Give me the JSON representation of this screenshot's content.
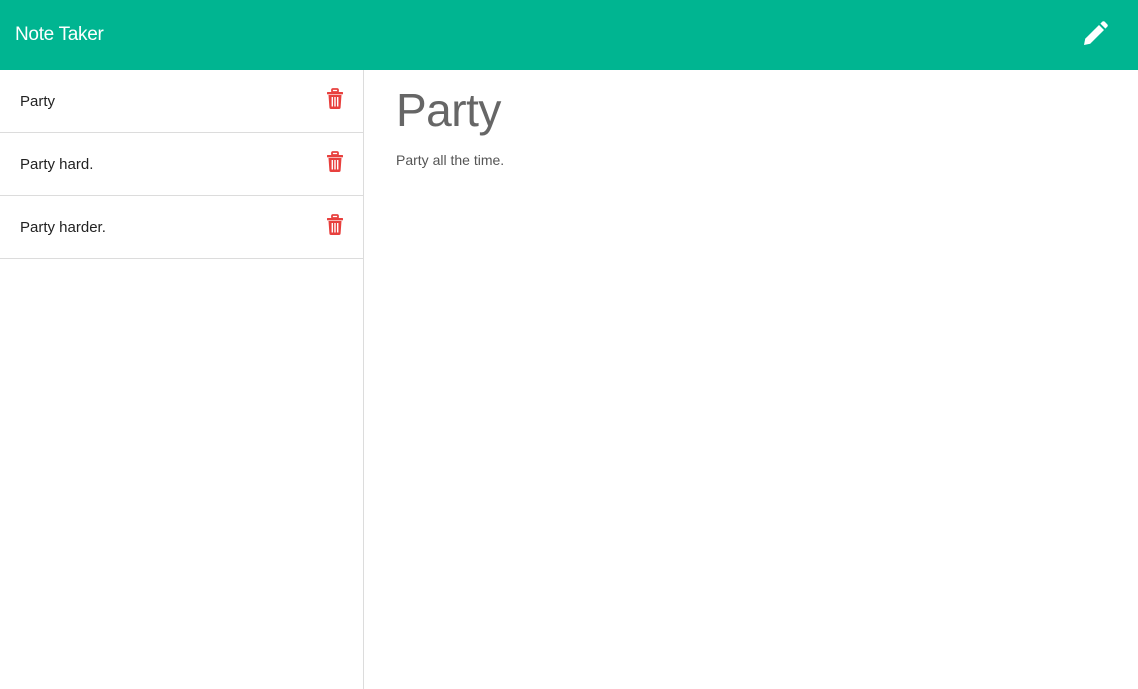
{
  "navbar": {
    "brand": "Note Taker",
    "new_note_icon": "pencil-icon",
    "background_color": "#00b591"
  },
  "notes": [
    {
      "title": "Party",
      "delete_icon": "trash-icon"
    },
    {
      "title": "Party hard.",
      "delete_icon": "trash-icon"
    },
    {
      "title": "Party harder.",
      "delete_icon": "trash-icon"
    }
  ],
  "active_note": {
    "title": "Party",
    "text": "Party all the time."
  },
  "colors": {
    "accent": "#00b591",
    "delete": "#e8403e"
  }
}
